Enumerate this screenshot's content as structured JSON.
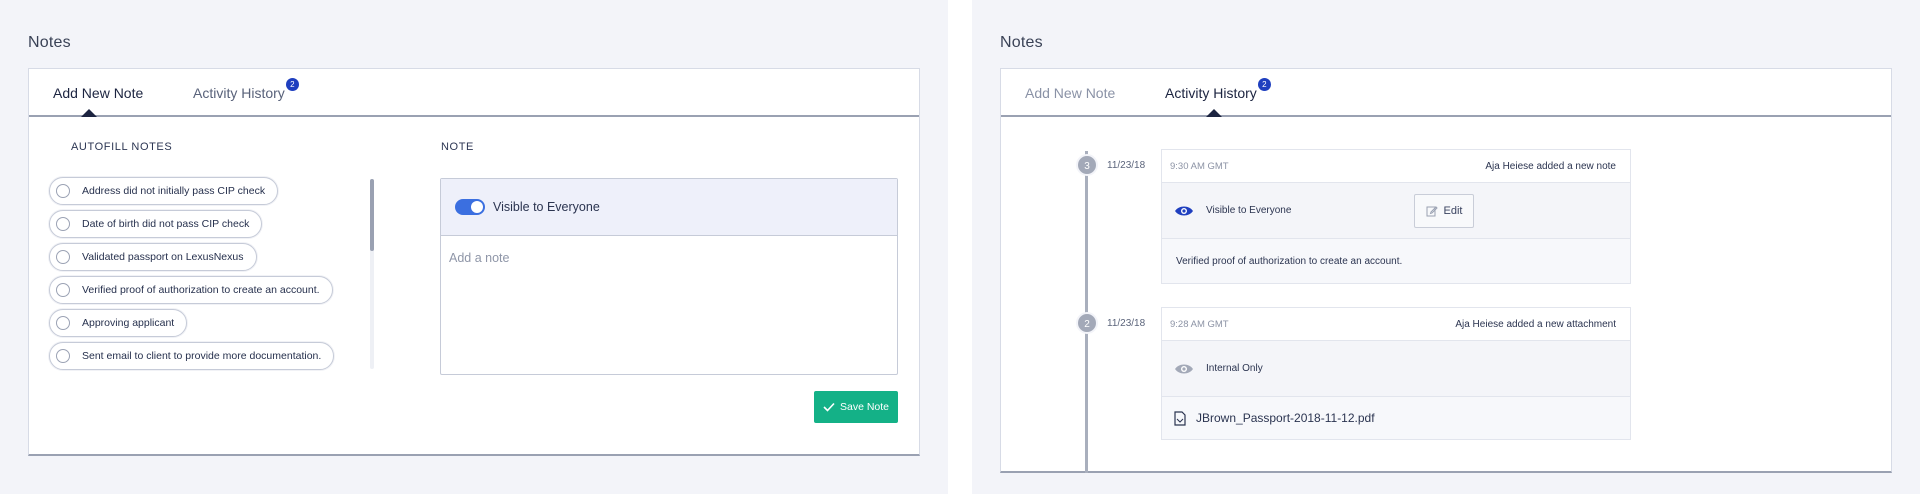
{
  "left": {
    "title": "Notes",
    "tabs": [
      {
        "label": "Add New Note",
        "active": true
      },
      {
        "label": "Activity History",
        "badge": "2",
        "active": false
      }
    ],
    "autofill_label": "AUTOFILL NOTES",
    "autofill_items": [
      "Address did not initially pass CIP check",
      "Date of birth did not pass CIP check",
      "Validated passport on LexusNexus",
      "Verified proof of authorization to create an account.",
      "Approving applicant",
      "Sent email to client to provide more documentation."
    ],
    "note_label": "NOTE",
    "visibility_label": "Visible to Everyone",
    "note_placeholder": "Add a note",
    "save_label": "Save Note"
  },
  "right": {
    "title": "Notes",
    "tabs": [
      {
        "label": "Add New Note",
        "active": false
      },
      {
        "label": "Activity History",
        "badge": "2",
        "active": true
      }
    ],
    "entries": [
      {
        "number": "3",
        "date": "11/23/18",
        "time": "9:30 AM GMT",
        "action": "Aja Heiese added a new note",
        "visibility": "Visible to Everyone",
        "edit_label": "Edit",
        "body": "Verified proof of authorization to create an account."
      },
      {
        "number": "2",
        "date": "11/23/18",
        "time": "9:28 AM GMT",
        "action": "Aja Heiese added a new attachment",
        "visibility": "Internal Only",
        "file": "JBrown_Passport-2018-11-12.pdf"
      }
    ]
  },
  "colors": {
    "accent_blue": "#1f3fbf",
    "toggle_blue": "#3b6fe0",
    "save_green": "#14b187",
    "background": "#f3f4f9"
  },
  "icons": {
    "check": "check-icon",
    "eye_visible": "eye-icon",
    "eye_internal": "eye-muted-icon",
    "edit": "pencil-icon",
    "file": "file-icon"
  }
}
